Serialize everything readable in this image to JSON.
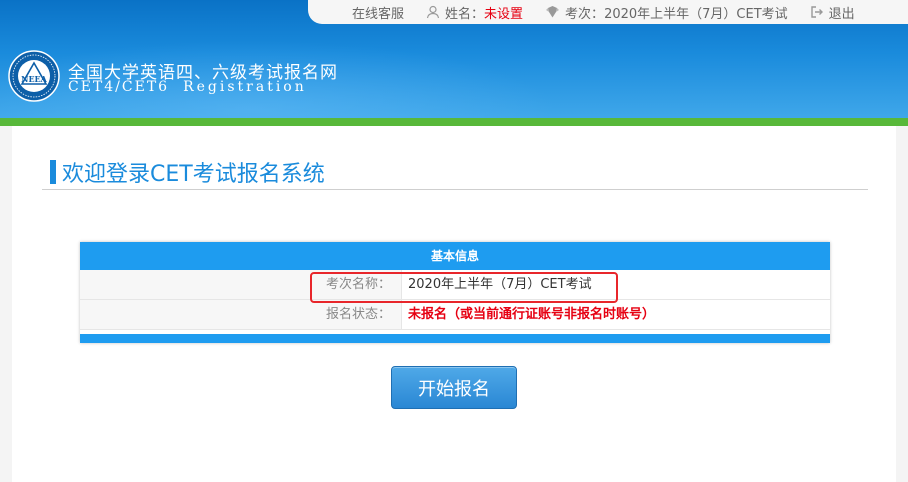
{
  "topbar": {
    "service": "在线客服",
    "name_label": "姓名：",
    "name_value": "未设置",
    "exam_label": "考次：",
    "exam_value": "2020年上半年（7月）CET考试",
    "logout": "退出"
  },
  "site": {
    "logo_text": "NEEA",
    "title": "全国大学英语四、六级考试报名网",
    "subtitle": "CET4/CET6",
    "subtitle_en": "Registration"
  },
  "welcome": {
    "title": "欢迎登录CET考试报名系统"
  },
  "info_table": {
    "header": "基本信息",
    "rows": [
      {
        "label": "考次名称：",
        "value": "2020年上半年（7月）CET考试"
      },
      {
        "label": "报名状态：",
        "value": "未报名（或当前通行证账号非报名时账号）"
      }
    ]
  },
  "actions": {
    "start_label": "开始报名"
  },
  "colors": {
    "brand_blue": "#1a8bdc",
    "table_blue": "#1e9cf0",
    "accent_green": "#58b83a",
    "alert_red": "#e60012"
  }
}
